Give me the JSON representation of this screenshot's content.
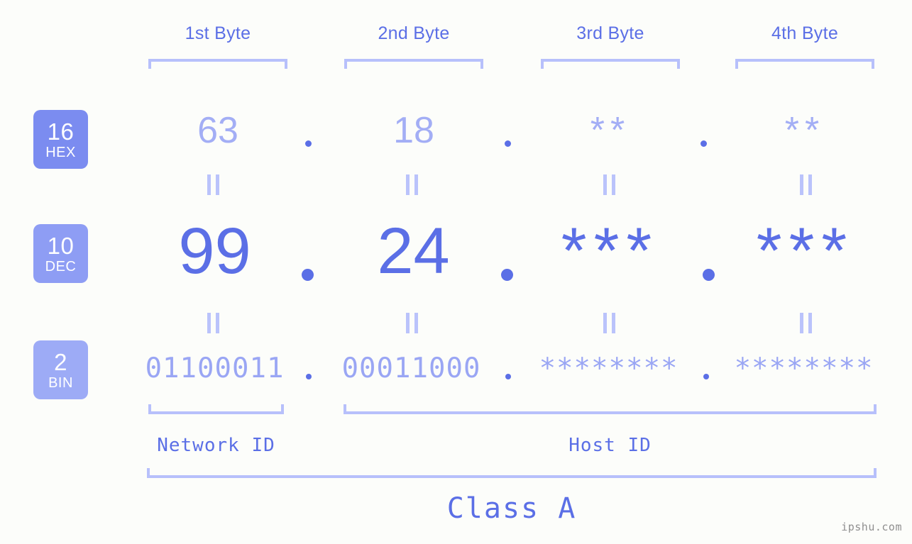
{
  "meta": {
    "background_color": "#fcfdfa",
    "accent_strong": "#5b6fe6",
    "accent_mid": "#9aa6f4",
    "accent_light": "#b7c0fb",
    "watermark": "ipshu.com"
  },
  "headers": [
    {
      "label": "1st Byte"
    },
    {
      "label": "2nd Byte"
    },
    {
      "label": "3rd Byte"
    },
    {
      "label": "4th Byte"
    }
  ],
  "bases": [
    {
      "number": "16",
      "abbr": "HEX",
      "badge_color": "#7b8cf0"
    },
    {
      "number": "10",
      "abbr": "DEC",
      "badge_color": "#8e9df4"
    },
    {
      "number": "2",
      "abbr": "BIN",
      "badge_color": "#9dabf6"
    }
  ],
  "rows": {
    "hex": {
      "base_label": "HEX",
      "values": [
        "63",
        "18",
        "**",
        "**"
      ],
      "separator": "."
    },
    "dec": {
      "base_label": "DEC",
      "values": [
        "99",
        "24",
        "***",
        "***"
      ],
      "separator": "."
    },
    "bin": {
      "base_label": "BIN",
      "values": [
        "01100011",
        "00011000",
        "********",
        "********"
      ],
      "separator": "."
    }
  },
  "equals_symbol": "=",
  "sections": {
    "network_id": {
      "label": "Network ID"
    },
    "host_id": {
      "label": "Host ID"
    },
    "class": {
      "label": "Class A"
    }
  }
}
